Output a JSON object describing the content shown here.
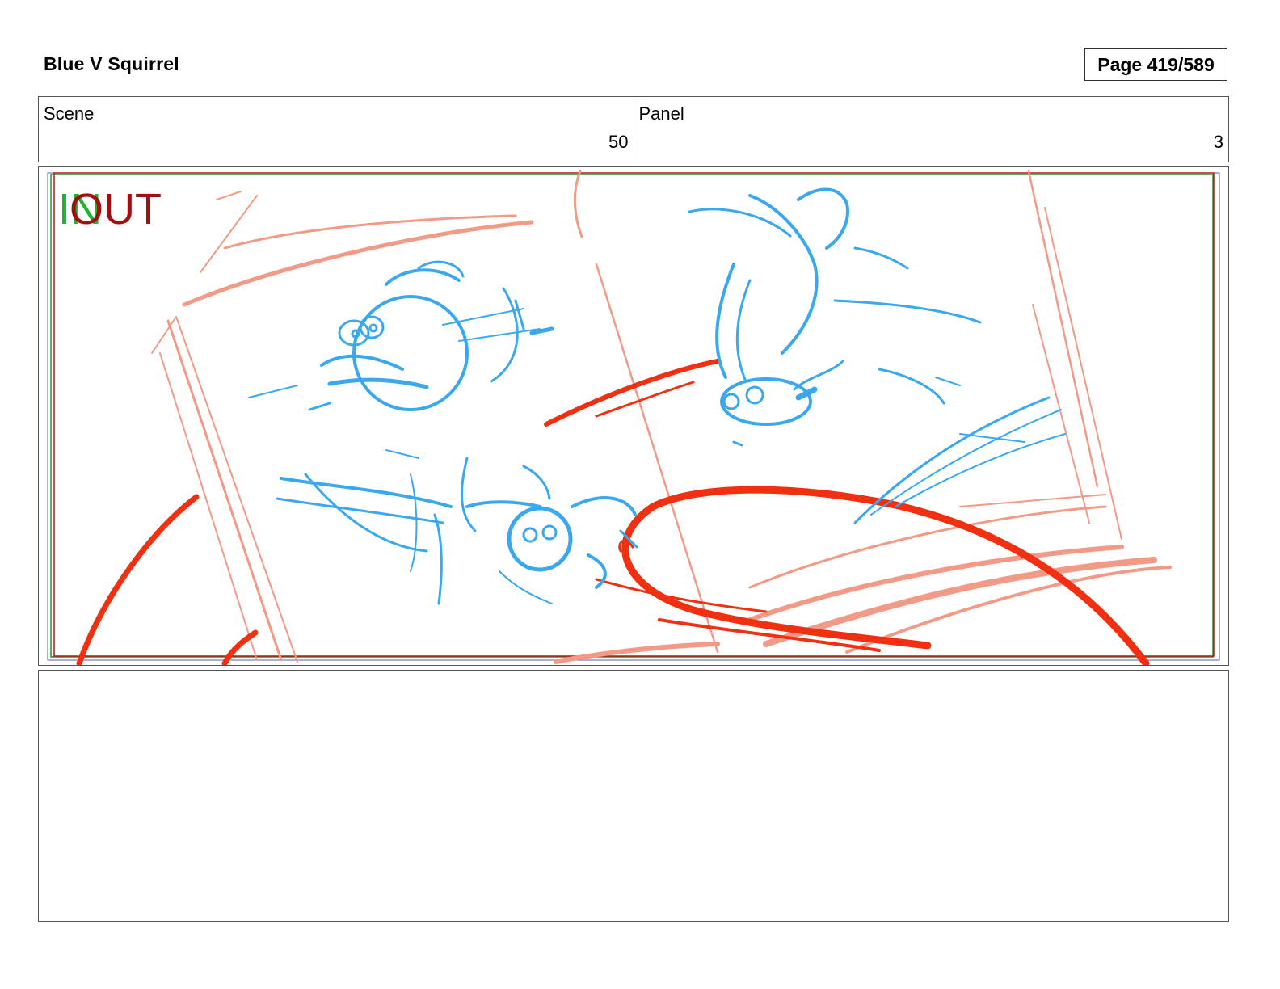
{
  "header": {
    "project_title": "Blue V Squirrel",
    "page_label": "Page 419/589"
  },
  "info": {
    "scene_label": "Scene",
    "scene_value": "50",
    "panel_label": "Panel",
    "panel_value": "3"
  },
  "frame": {
    "in_marker": "IN",
    "out_marker": "OUT",
    "colors": {
      "sketch_blue": "#3aa8ee",
      "sketch_red": "#f03010",
      "sketch_salmon": "#f39a86",
      "in_green": "#22b430",
      "out_red": "#a01010"
    }
  },
  "notes": {
    "text": ""
  }
}
